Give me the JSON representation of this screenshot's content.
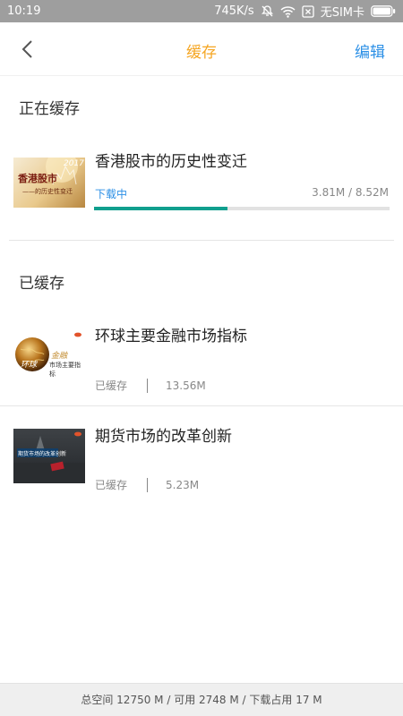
{
  "status_bar": {
    "time": "10:19",
    "speed": "745K/s",
    "carrier": "无SIM卡",
    "icons": [
      "mute-icon",
      "wifi-icon",
      "no-sim-icon",
      "battery-icon"
    ]
  },
  "header": {
    "back_icon": "chevron-left-icon",
    "title": "缓存",
    "edit_label": "编辑",
    "title_color": "#f5a623",
    "accent_color": "#2b8fe6"
  },
  "downloading": {
    "section_title": "正在缓存",
    "items": [
      {
        "title": "香港股市的历史性变迁",
        "thumb_title": "香港股市",
        "thumb_subtitle": "——的历史性变迁",
        "thumb_year": "2017",
        "status": "下载中",
        "size": "3.81M / 8.52M",
        "progress": 0.45,
        "progress_color": "#109f8e"
      }
    ]
  },
  "cached": {
    "section_title": "已缓存",
    "items": [
      {
        "title": "环球主要金融市场指标",
        "thumb_title": "金融",
        "thumb_subtitle": "市场主要指标",
        "thumb_globe": "环球",
        "status": "已缓存",
        "size": "13.56M"
      },
      {
        "title": "期货市场的改革创新",
        "thumb_title": "期货市场的改革创新",
        "status": "已缓存",
        "size": "5.23M"
      }
    ]
  },
  "footer": {
    "storage_text": "总空间 12750 M / 可用 2748 M / 下载占用 17 M"
  }
}
